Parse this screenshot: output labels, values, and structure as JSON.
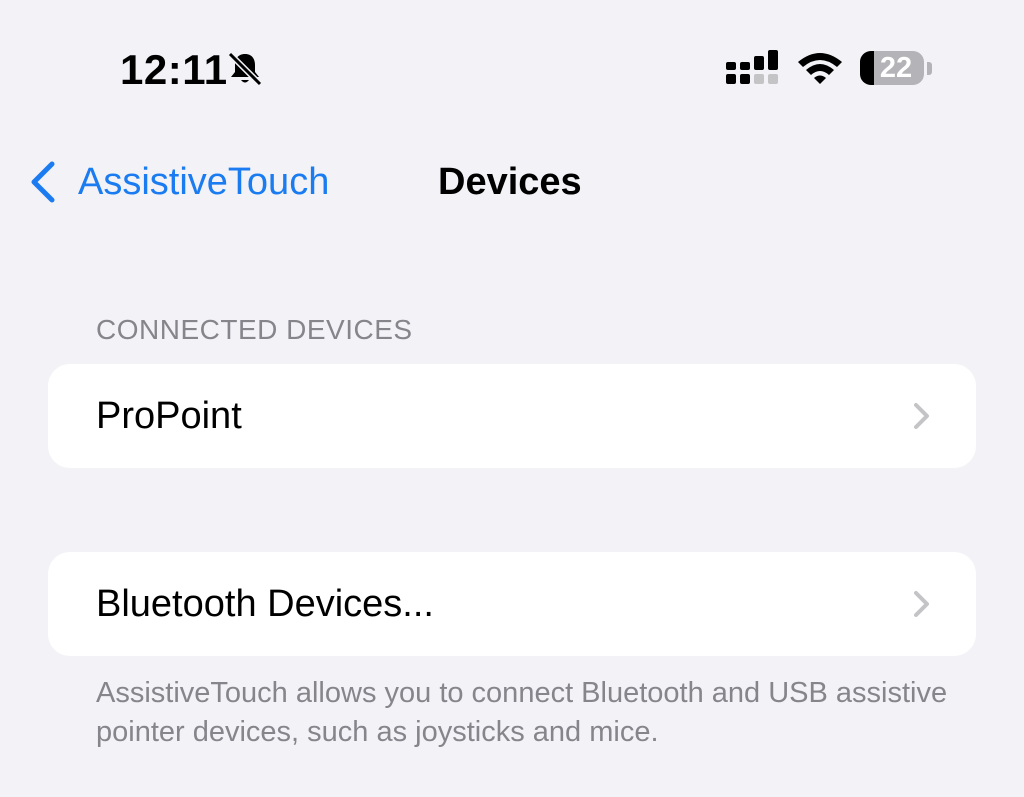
{
  "status_bar": {
    "time": "12:11",
    "battery_percent": "22",
    "icons": [
      "bell-slash-icon",
      "cellular-signal-icon",
      "wifi-icon",
      "battery-icon"
    ]
  },
  "nav": {
    "back_label": "AssistiveTouch",
    "title": "Devices"
  },
  "connected_section": {
    "header": "CONNECTED DEVICES",
    "items": [
      {
        "label": "ProPoint"
      }
    ]
  },
  "bluetooth_section": {
    "label": "Bluetooth Devices...",
    "footer": "AssistiveTouch allows you to connect Bluetooth and USB assistive pointer devices, such as joysticks and mice."
  },
  "colors": {
    "background": "#f2f2f7",
    "accent": "#1a7cf0",
    "secondary_text": "#85858b",
    "chevron": "#c4c4c7"
  }
}
